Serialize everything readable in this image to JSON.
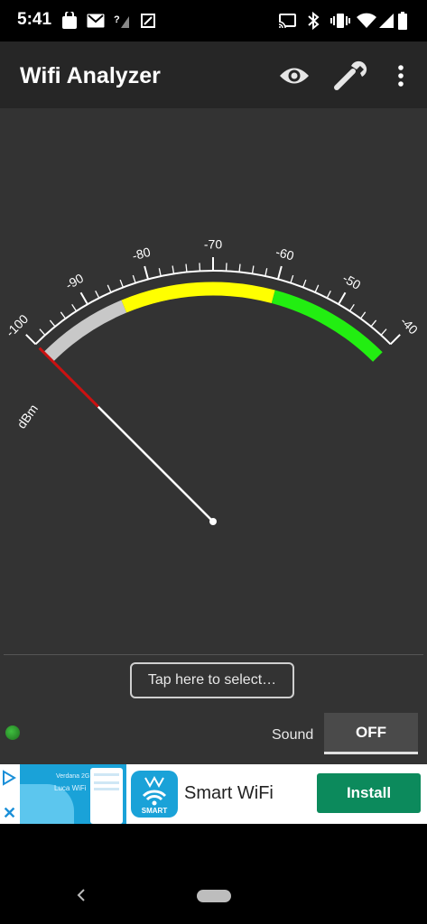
{
  "status_bar": {
    "time": "5:41",
    "left_icons": [
      "shopping-bag-icon",
      "gmail-icon",
      "no-signal-icon",
      "screenshot-icon"
    ],
    "right_icons": [
      "cast-icon",
      "bluetooth-icon",
      "vibrate-icon",
      "wifi-icon",
      "cell-signal-icon",
      "battery-icon"
    ]
  },
  "app_bar": {
    "title": "Wifi Analyzer",
    "actions": [
      "eye-icon",
      "wrench-icon",
      "overflow-menu-icon"
    ]
  },
  "gauge": {
    "unit": "dBm",
    "min": -100,
    "max": -40,
    "labels": [
      "-100",
      "-90",
      "-80",
      "-70",
      "-60",
      "-50",
      "-40"
    ],
    "current_value": -100,
    "zones": [
      {
        "from": -100,
        "to": -85,
        "color": "#c8c8c8"
      },
      {
        "from": -85,
        "to": -60,
        "color": "#ffff00"
      },
      {
        "from": -60,
        "to": -40,
        "color": "#22ee11"
      }
    ],
    "needle_color": "#ffffff",
    "needle_tip_color": "#cc1111"
  },
  "controls": {
    "select_button": "Tap here to select…",
    "sound_label": "Sound",
    "sound_toggle": "OFF"
  },
  "ad": {
    "thumb_text_1": "Verdana 2G",
    "thumb_text_2": "Luca WiFi",
    "logo_brand": "SMART",
    "title": "Smart WiFi",
    "install_label": "Install"
  },
  "colors": {
    "appbar": "#262626",
    "background": "#333333",
    "install_button": "#0c8a5c",
    "led": "#2e8b2e"
  }
}
